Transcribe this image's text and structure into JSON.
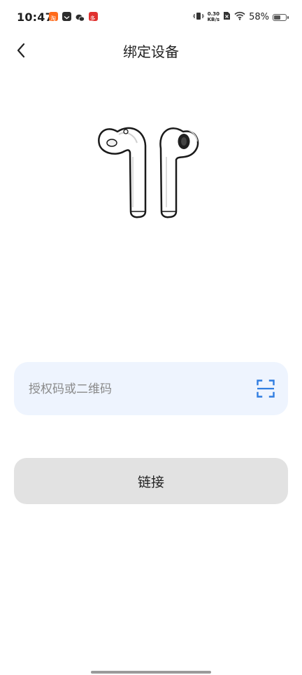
{
  "status_bar": {
    "time": "10:47",
    "net_speed_value": "0.30",
    "net_speed_unit": "KB/s",
    "battery_text": "58%",
    "battery_level": 0.58,
    "notification_icons": [
      "shopping-app-icon",
      "mail-icon",
      "wechat-icon",
      "red-app-icon"
    ]
  },
  "header": {
    "title": "绑定设备"
  },
  "illustration": {
    "name": "earbuds-icon"
  },
  "code_field": {
    "value": "",
    "placeholder": "授权码或二维码"
  },
  "actions": {
    "connect_label": "链接"
  },
  "colors": {
    "field_bg": "#eef4fe",
    "scan_icon": "#2f7de1",
    "button_bg": "#e2e2e2"
  }
}
